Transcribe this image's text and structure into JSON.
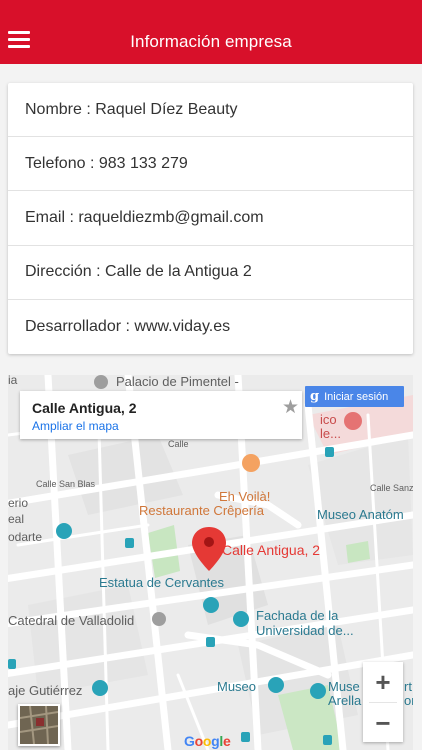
{
  "header": {
    "title": "Información empresa"
  },
  "info": {
    "nombre": "Nombre : Raquel Díez Beauty",
    "telefono": "Telefono : 983 133 279",
    "email": "Email : raqueldiezmb@gmail.com",
    "direccion": "Dirección : Calle de la Antigua 2",
    "desarrollador": "Desarrollador : www.viday.es"
  },
  "map": {
    "card_title": "Calle Antigua, 2",
    "card_link": "Ampliar el mapa",
    "signin": "Iniciar sesión",
    "signin_g": "g",
    "marker_label": "Calle Antigua, 2",
    "zoom_in": "+",
    "zoom_out": "−",
    "logo": [
      "G",
      "o",
      "o",
      "g",
      "l",
      "e"
    ],
    "labels": {
      "palacio": "Palacio de Pimentel -",
      "ico": "ico",
      "le": "le...",
      "calle_san_blas": "Calle San Blas",
      "calle_v": "Calle",
      "calle_sanz": "Calle Sanz",
      "eh_voila": "Eh Voilà!",
      "restaurante": "Restaurante Crêpería",
      "museo_anatom": "Museo Anatóm",
      "erio": "erio",
      "eal": "eal",
      "odarte": "odarte",
      "estatua": "Estatua de Cervantes",
      "catedral": "Catedral de Valladolid",
      "fachada1": "Fachada de la",
      "fachada2": "Universidad de...",
      "aje": "aje Gutiérrez",
      "museo": "Museo",
      "muse": "Muse",
      "arella": "Arella",
      "rt": "rt",
      "on": "on",
      "ia": "ia"
    }
  },
  "colors": {
    "accent": "#d8102a",
    "link": "#1a73e8",
    "signin": "#4a86e8",
    "marker": "#e53935"
  }
}
